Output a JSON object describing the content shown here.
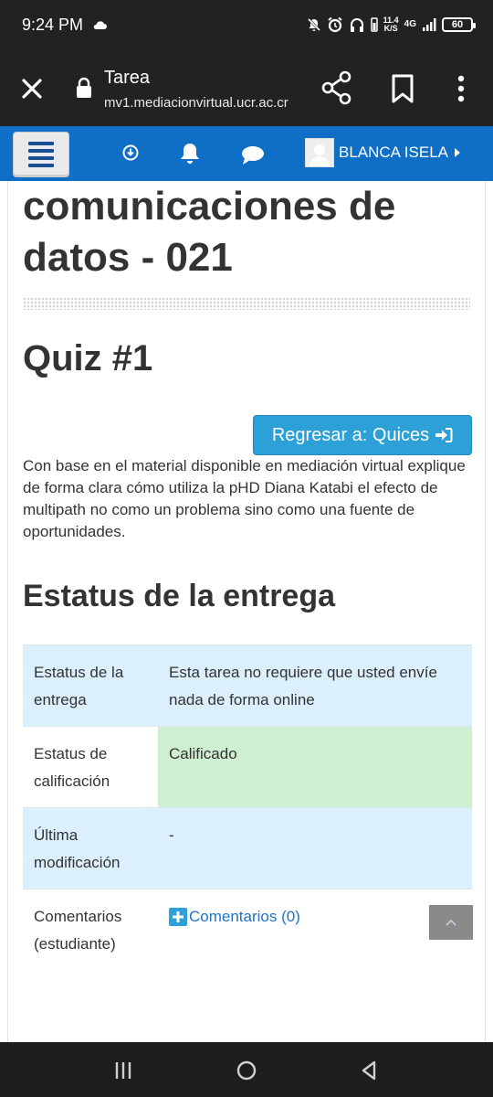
{
  "status_bar": {
    "time": "9:24 PM",
    "speed_value": "11.4",
    "speed_unit": "K/S",
    "network": "4G",
    "battery": "60"
  },
  "browser": {
    "title": "Tarea",
    "url": "mv1.mediacionvirtual.ucr.ac.cr"
  },
  "site_nav": {
    "user_name": "BLANCA ISELA"
  },
  "page": {
    "course_title": "comunicaciones de datos - 021",
    "quiz_title": "Quiz #1",
    "back_button": "Regresar a: Quices",
    "intro": "Con base en el material disponible en mediación virtual explique de forma clara cómo utiliza la pHD Diana Katabi el efecto de multipath no como un problema sino como una fuente de oportunidades.",
    "section_heading": "Estatus de la entrega",
    "table": {
      "rows": [
        {
          "label": "Estatus de la entrega",
          "value": "Esta tarea no requiere que usted envíe nada de forma online"
        },
        {
          "label": "Estatus de calificación",
          "value": "Calificado"
        },
        {
          "label": "Última modificación",
          "value": "-"
        },
        {
          "label": "Comentarios (estudiante)",
          "value": "Comentarios (0)"
        }
      ]
    }
  }
}
